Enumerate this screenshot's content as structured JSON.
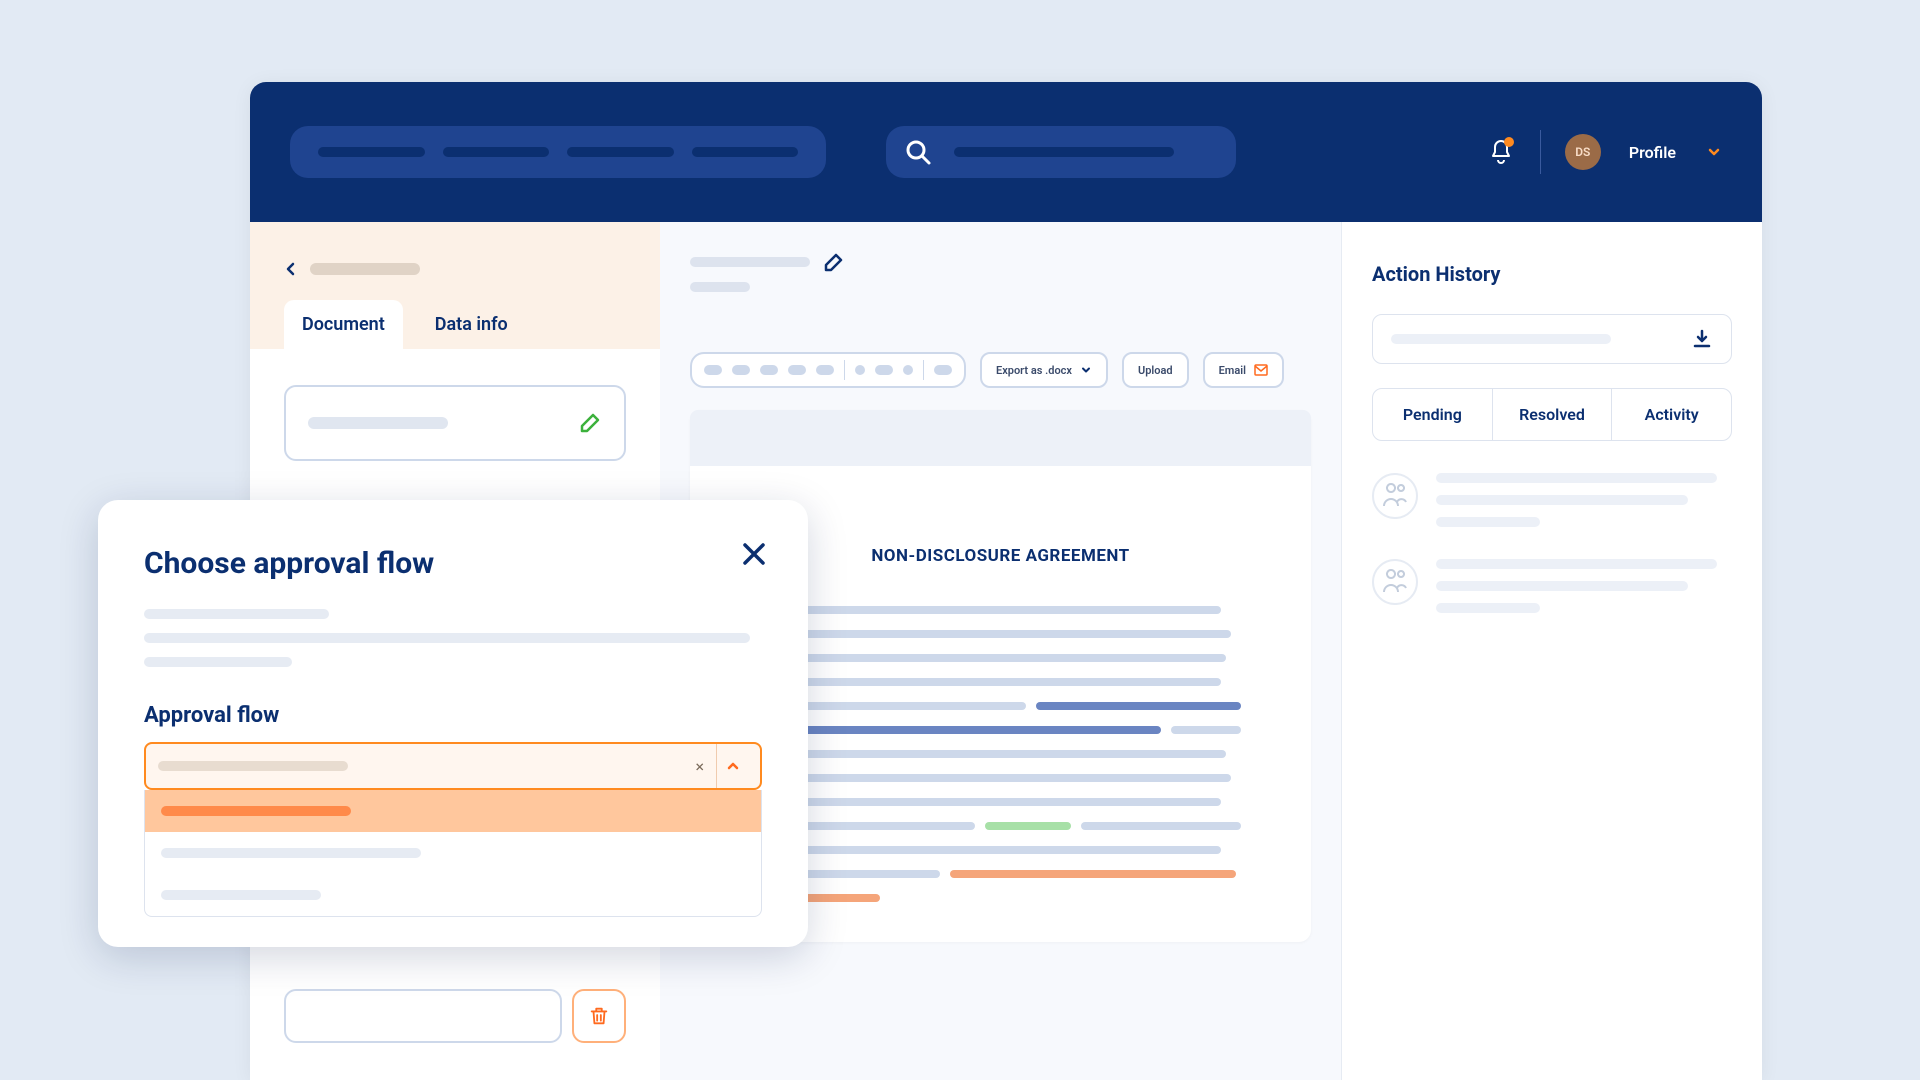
{
  "topbar": {
    "profile_label": "Profile",
    "avatar_initials": "DS"
  },
  "sidebar": {
    "tab_document": "Document",
    "tab_data_info": "Data info"
  },
  "right_panel": {
    "title": "Action History",
    "tab_pending": "Pending",
    "tab_resolved": "Resolved",
    "tab_activity": "Activity"
  },
  "document": {
    "export_label": "Export as .docx",
    "upload_label": "Upload",
    "email_label": "Email",
    "title": "NON-DISCLOSURE AGREEMENT"
  },
  "modal": {
    "title": "Choose approval flow",
    "subtitle": "Approval flow"
  }
}
